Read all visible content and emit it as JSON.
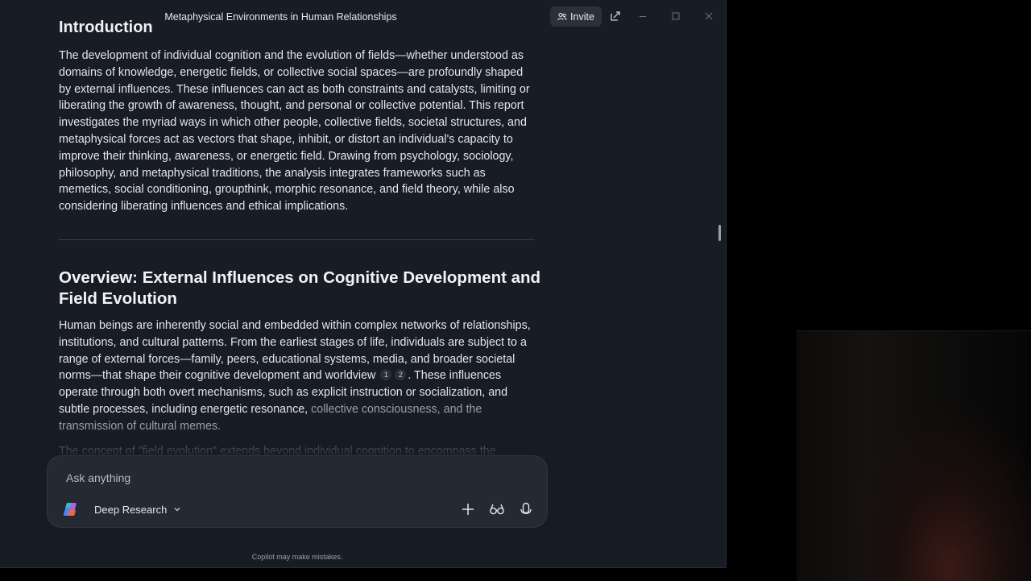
{
  "window": {
    "title": "Metaphysical Environments in Human Relationships",
    "invite_label": "Invite"
  },
  "document": {
    "intro_heading": "Introduction",
    "intro_paragraph": "The development of individual cognition and the evolution of fields—whether understood as domains of knowledge, energetic fields, or collective social spaces—are profoundly shaped by external influences. These influences can act as both constraints and catalysts, limiting or liberating the growth of awareness, thought, and personal or collective potential. This report investigates the myriad ways in which other people, collective fields, societal structures, and metaphysical forces act as vectors that shape, inhibit, or distort an individual's capacity to improve their thinking, awareness, or energetic field. Drawing from psychology, sociology, philosophy, and metaphysical traditions, the analysis integrates frameworks such as memetics, social conditioning, groupthink, morphic resonance, and field theory, while also considering liberating influences and ethical implications.",
    "overview_heading": "Overview: External Influences on Cognitive Development and Field Evolution",
    "overview_p_part1": "Human beings are inherently social and embedded within complex networks of relationships, institutions, and cultural patterns. From the earliest stages of life, individuals are subject to a range of external forces—family, peers, educational systems, media, and broader societal norms—that shape their cognitive development and worldview",
    "citation_1": "1",
    "citation_2": "2",
    "overview_p_part2": ". These influences operate through both overt mechanisms, such as explicit instruction or socialization, and subtle processes, including energetic resonance,",
    "overview_p_part3": "collective consciousness, and the transmission of cultural memes.",
    "faded_next_line": "The concept of \"field evolution\" extends beyond individual cognition to encompass the"
  },
  "composer": {
    "placeholder": "Ask anything",
    "mode_label": "Deep Research"
  },
  "footer": {
    "disclaimer": "Copilot may make mistakes."
  },
  "icons": {
    "invite": "people-icon",
    "popout": "popout-icon",
    "minimize": "minimize-icon",
    "maximize": "maximize-icon",
    "close": "close-icon",
    "add": "plus-icon",
    "vision": "glasses-icon",
    "voice": "microphone-icon"
  }
}
